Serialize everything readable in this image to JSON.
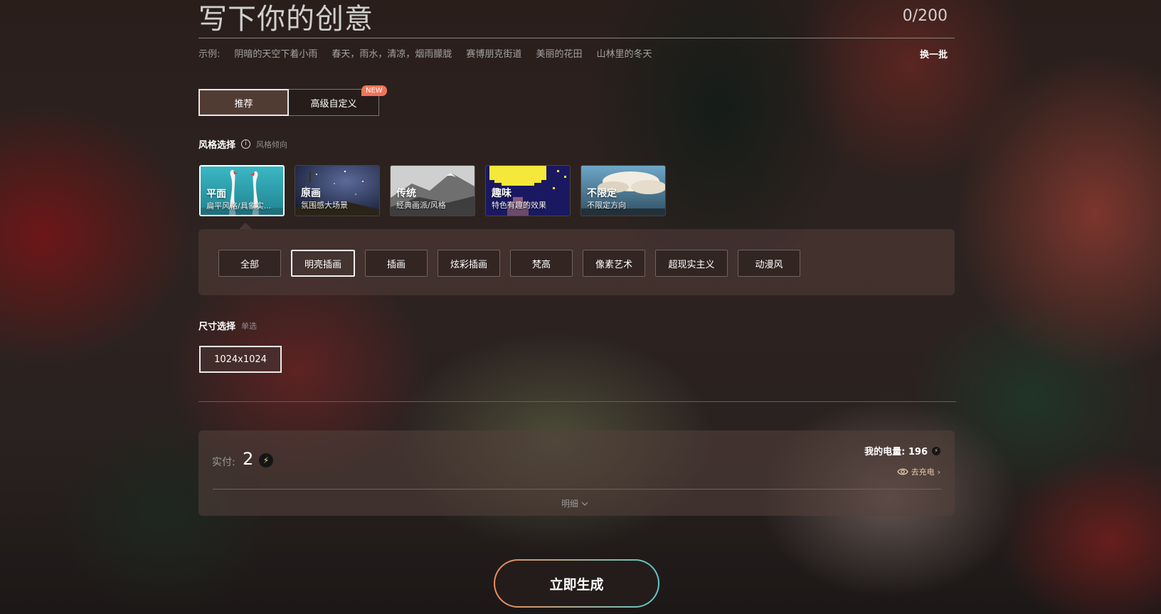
{
  "header": {
    "title": "写下你的创意",
    "counter": "0/200"
  },
  "examples": {
    "label": "示例:",
    "items": [
      "阴暗的天空下着小雨",
      "春天，雨水，清凉，烟雨朦胧",
      "赛博朋克街道",
      "美丽的花田",
      "山林里的冬天"
    ],
    "refresh": "换一批"
  },
  "tabs": [
    {
      "label": "推荐",
      "active": true
    },
    {
      "label": "高级自定义",
      "active": false
    }
  ],
  "new_badge": "NEW",
  "style_section": {
    "label": "风格选择",
    "info_icon": "info-icon",
    "sub": "风格倾向",
    "cards": [
      {
        "name": "平面",
        "desc": "扁平风格/具象实...",
        "selected": true
      },
      {
        "name": "原画",
        "desc": "氛围感大场景",
        "selected": false
      },
      {
        "name": "传统",
        "desc": "经典画派/风格",
        "selected": false
      },
      {
        "name": "趣味",
        "desc": "特色有趣的效果",
        "selected": false
      },
      {
        "name": "不限定",
        "desc": "不限定方向",
        "selected": false
      }
    ]
  },
  "substyles": [
    {
      "label": "全部",
      "selected": false
    },
    {
      "label": "明亮插画",
      "selected": true
    },
    {
      "label": "插画",
      "selected": false
    },
    {
      "label": "炫彩插画",
      "selected": false
    },
    {
      "label": "梵高",
      "selected": false
    },
    {
      "label": "像素艺术",
      "selected": false
    },
    {
      "label": "超现实主义",
      "selected": false
    },
    {
      "label": "动漫风",
      "selected": false
    }
  ],
  "size_section": {
    "label": "尺寸选择",
    "sub": "单选",
    "option": "1024x1024"
  },
  "payment": {
    "label": "实付:",
    "amount": "2",
    "balance_label": "我的电量: 196",
    "recharge": "去充电",
    "details": "明细"
  },
  "generate_button": "立即生成",
  "colors": {
    "badge": "#f07558",
    "button_gradient_start": "#f08a5a",
    "button_gradient_end": "#5cc9c8",
    "recharge": "#e6c9a8"
  }
}
